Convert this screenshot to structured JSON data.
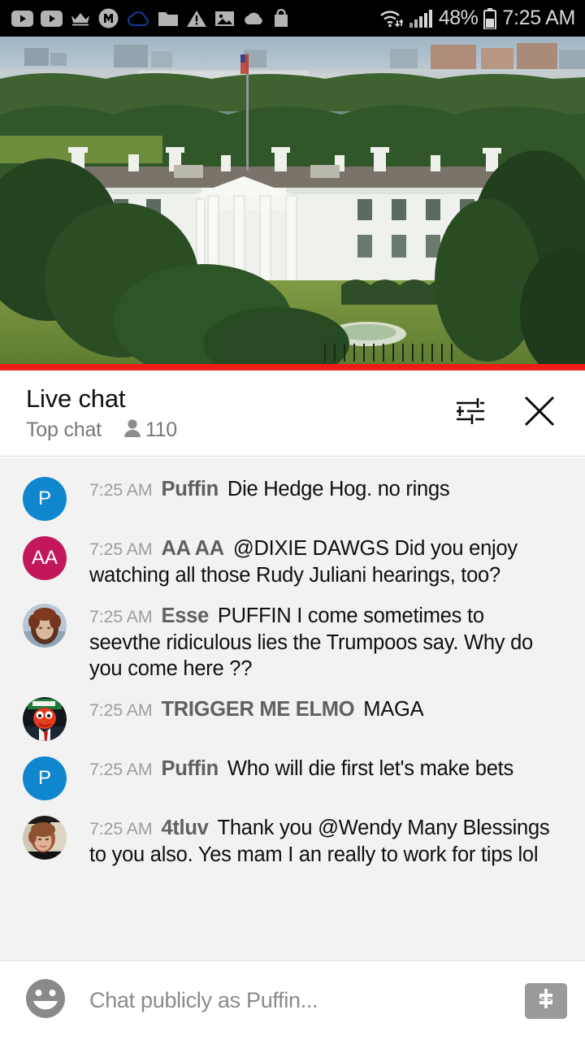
{
  "status_bar": {
    "time": "7:25 AM",
    "battery_percent": "48%",
    "icons": [
      "youtube-icon",
      "youtube-icon",
      "crown-icon",
      "m-circle-icon",
      "cloud-outline-icon",
      "folder-icon",
      "warning-triangle-icon",
      "image-icon",
      "cloud-filled-icon",
      "shopping-bag-icon"
    ],
    "right_icons": [
      "wifi-icon",
      "cellular-signal-icon",
      "battery-icon"
    ],
    "colors": {
      "background": "#000000",
      "text": "#d8d8d8",
      "cloud_outline": "#123a8f"
    }
  },
  "video": {
    "description": "White House live stream",
    "progress_color": "#ec1c16"
  },
  "chat_header": {
    "title": "Live chat",
    "subtitle": "Top chat",
    "viewer_count": "110",
    "viewer_icon": "person-icon",
    "settings_icon": "tune-sliders-icon",
    "close_icon": "close-x-icon"
  },
  "messages": [
    {
      "time": "7:25 AM",
      "author": "Puffin",
      "text": "Die Hedge Hog. no rings",
      "avatar_type": "initials",
      "avatar_initials": "P",
      "avatar_color": "#0f87ce"
    },
    {
      "time": "7:25 AM",
      "author": "AA AA",
      "text": "@DIXIE DAWGS Did you enjoy watching all those Rudy Juliani hearings, too?",
      "avatar_type": "initials",
      "avatar_initials": "AA",
      "avatar_color": "#c2185b"
    },
    {
      "time": "7:25 AM",
      "author": "Esse",
      "text": "PUFFIN I come sometimes to seevthe ridiculous lies the Trumpoos say. Why do you come here ??",
      "avatar_type": "photo",
      "avatar_photo": "woman-curly-auburn-hair-photo"
    },
    {
      "time": "7:25 AM",
      "author": "TRIGGER ME ELMO",
      "text": "MAGA",
      "avatar_type": "photo",
      "avatar_photo": "elmo-in-suit-photo"
    },
    {
      "time": "7:25 AM",
      "author": "Puffin",
      "text": "Who will die first let's make bets",
      "avatar_type": "initials",
      "avatar_initials": "P",
      "avatar_color": "#0f87ce"
    },
    {
      "time": "7:25 AM",
      "author": "4tluv",
      "text": "Thank you @Wendy Many Blessings to you also. Yes mam I an really to work for tips lol",
      "avatar_type": "photo",
      "avatar_photo": "woman-short-red-hair-photo"
    }
  ],
  "input_bar": {
    "emoji_icon": "emoji-smiley-icon",
    "placeholder": "Chat publicly as Puffin...",
    "value": "",
    "superchat_icon": "dollar-sign-icon"
  }
}
